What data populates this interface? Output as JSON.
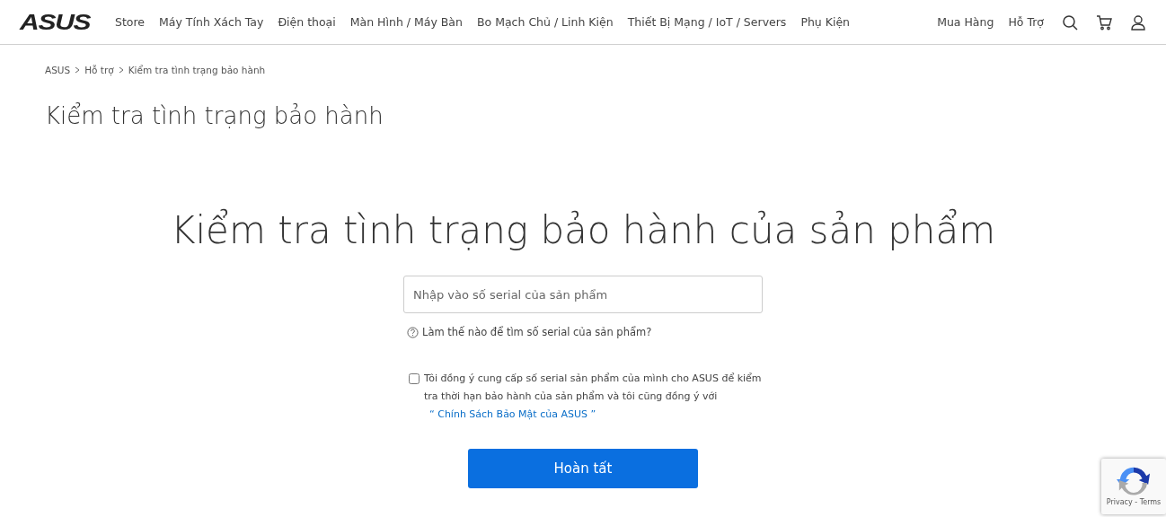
{
  "header": {
    "logo": "ASUS",
    "nav": [
      "Store",
      "Máy Tính Xách Tay",
      "Điện thoại",
      "Màn Hình / Máy Bàn",
      "Bo Mạch Chủ / Linh Kiện",
      "Thiết Bị Mạng / IoT / Servers",
      "Phụ Kiện"
    ],
    "right_links": [
      "Mua Hàng",
      "Hỗ Trợ"
    ]
  },
  "breadcrumb": [
    "ASUS",
    "Hỗ trợ",
    "Kiểm tra tình trạng bảo hành"
  ],
  "page_title": "Kiểm tra tình trạng bảo hành",
  "heading": "Kiểm tra tình trạng bảo hành của sản phẩm",
  "serial_field": {
    "placeholder": "Nhập vào số serial của sản phẩm"
  },
  "help_link": "Làm thế nào để tìm số serial của sản phẩm?",
  "consent": {
    "checked": false,
    "text": "Tôi đồng ý cung cấp số serial sản phẩm của mình cho ASUS để kiểm tra thời hạn bảo hành của sản phẩm và tôi cũng đồng ý với ",
    "link": "“ Chính Sách Bảo Mật của ASUS ”"
  },
  "submit": "Hoàn tất",
  "recaptcha": {
    "links": "Privacy - Terms"
  }
}
